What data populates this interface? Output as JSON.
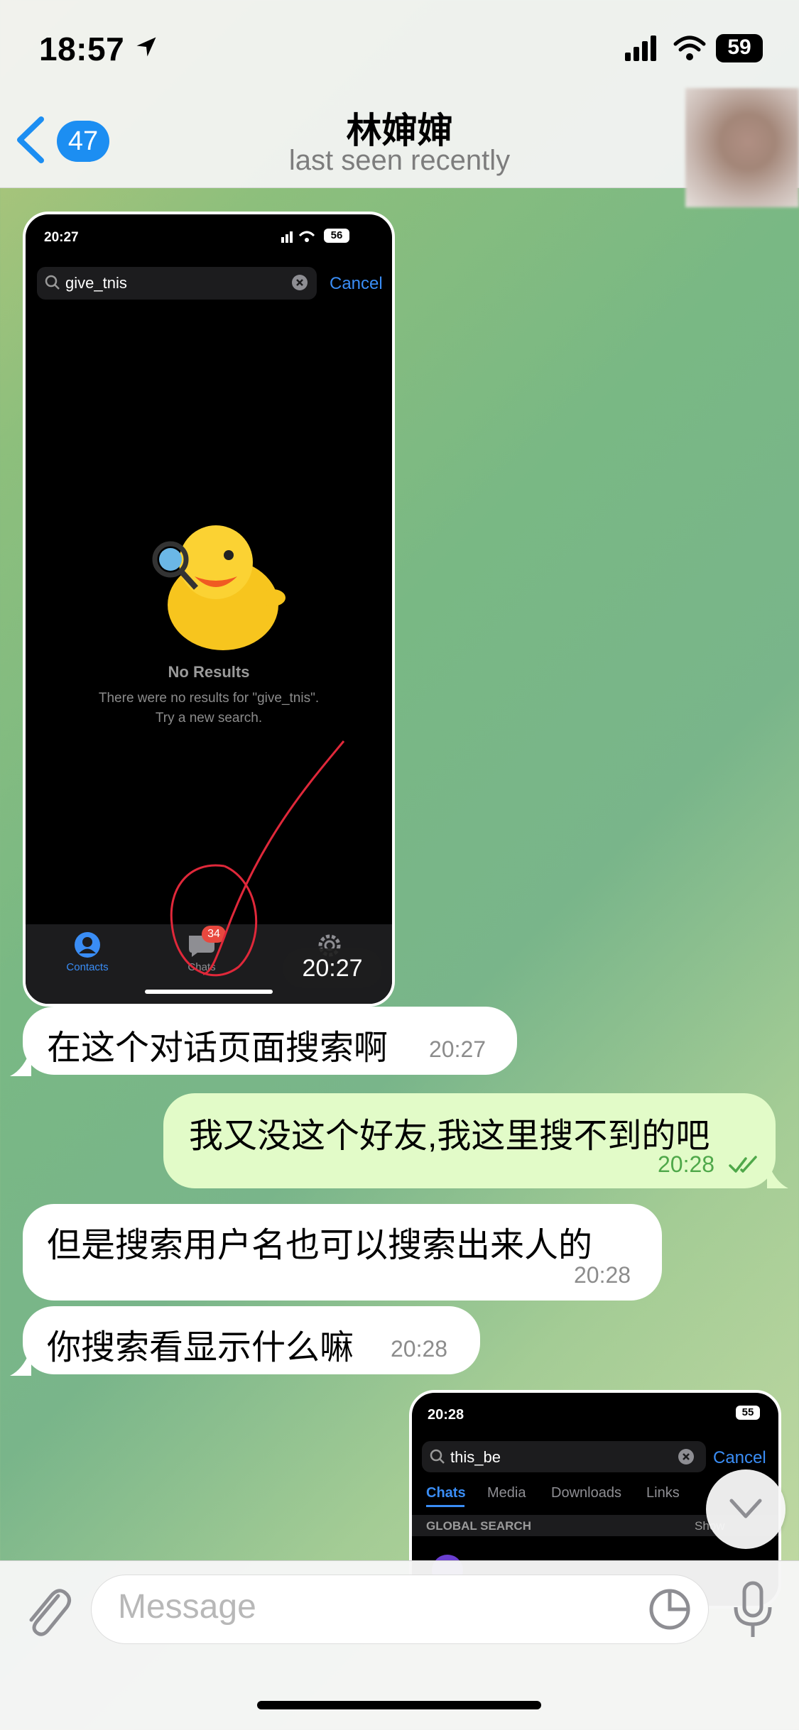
{
  "status_bar": {
    "time": "18:57",
    "battery": "59"
  },
  "header": {
    "back_count": "47",
    "title": "林婶婶",
    "subtitle": "last seen recently"
  },
  "screenshot1": {
    "status_time": "20:27",
    "battery": "56",
    "search_query": "give_tnis",
    "cancel_label": "Cancel",
    "no_results_title": "No Results",
    "no_results_line1": "There were no results for \"give_tnis\".",
    "no_results_line2": "Try a new search.",
    "tabs": [
      {
        "label": "Contacts"
      },
      {
        "label": "Chats",
        "badge": "34"
      },
      {
        "label": ""
      }
    ],
    "time_badge": "20:27"
  },
  "messages": [
    {
      "direction": "in",
      "text": "在这个对话页面搜索啊",
      "time": "20:27"
    },
    {
      "direction": "out",
      "text": "我又没这个好友,我这里搜不到的吧",
      "time": "20:28"
    },
    {
      "direction": "in",
      "text": "但是搜索用户名也可以搜索出来人的",
      "time": "20:28"
    },
    {
      "direction": "in",
      "text": "你搜索看显示什么嘛",
      "time": "20:28"
    }
  ],
  "screenshot2": {
    "status_time": "20:28",
    "battery": "55",
    "search_query": "this_be",
    "cancel_label": "Cancel",
    "tabs": [
      "Chats",
      "Media",
      "Downloads",
      "Links"
    ],
    "section_label": "GLOBAL SEARCH",
    "section_action": "Show"
  },
  "input": {
    "placeholder": "Message"
  },
  "colors": {
    "accent": "#1c8ef2",
    "outgoing_bubble": "#e2fbc8",
    "outgoing_time": "#4fa84a"
  }
}
